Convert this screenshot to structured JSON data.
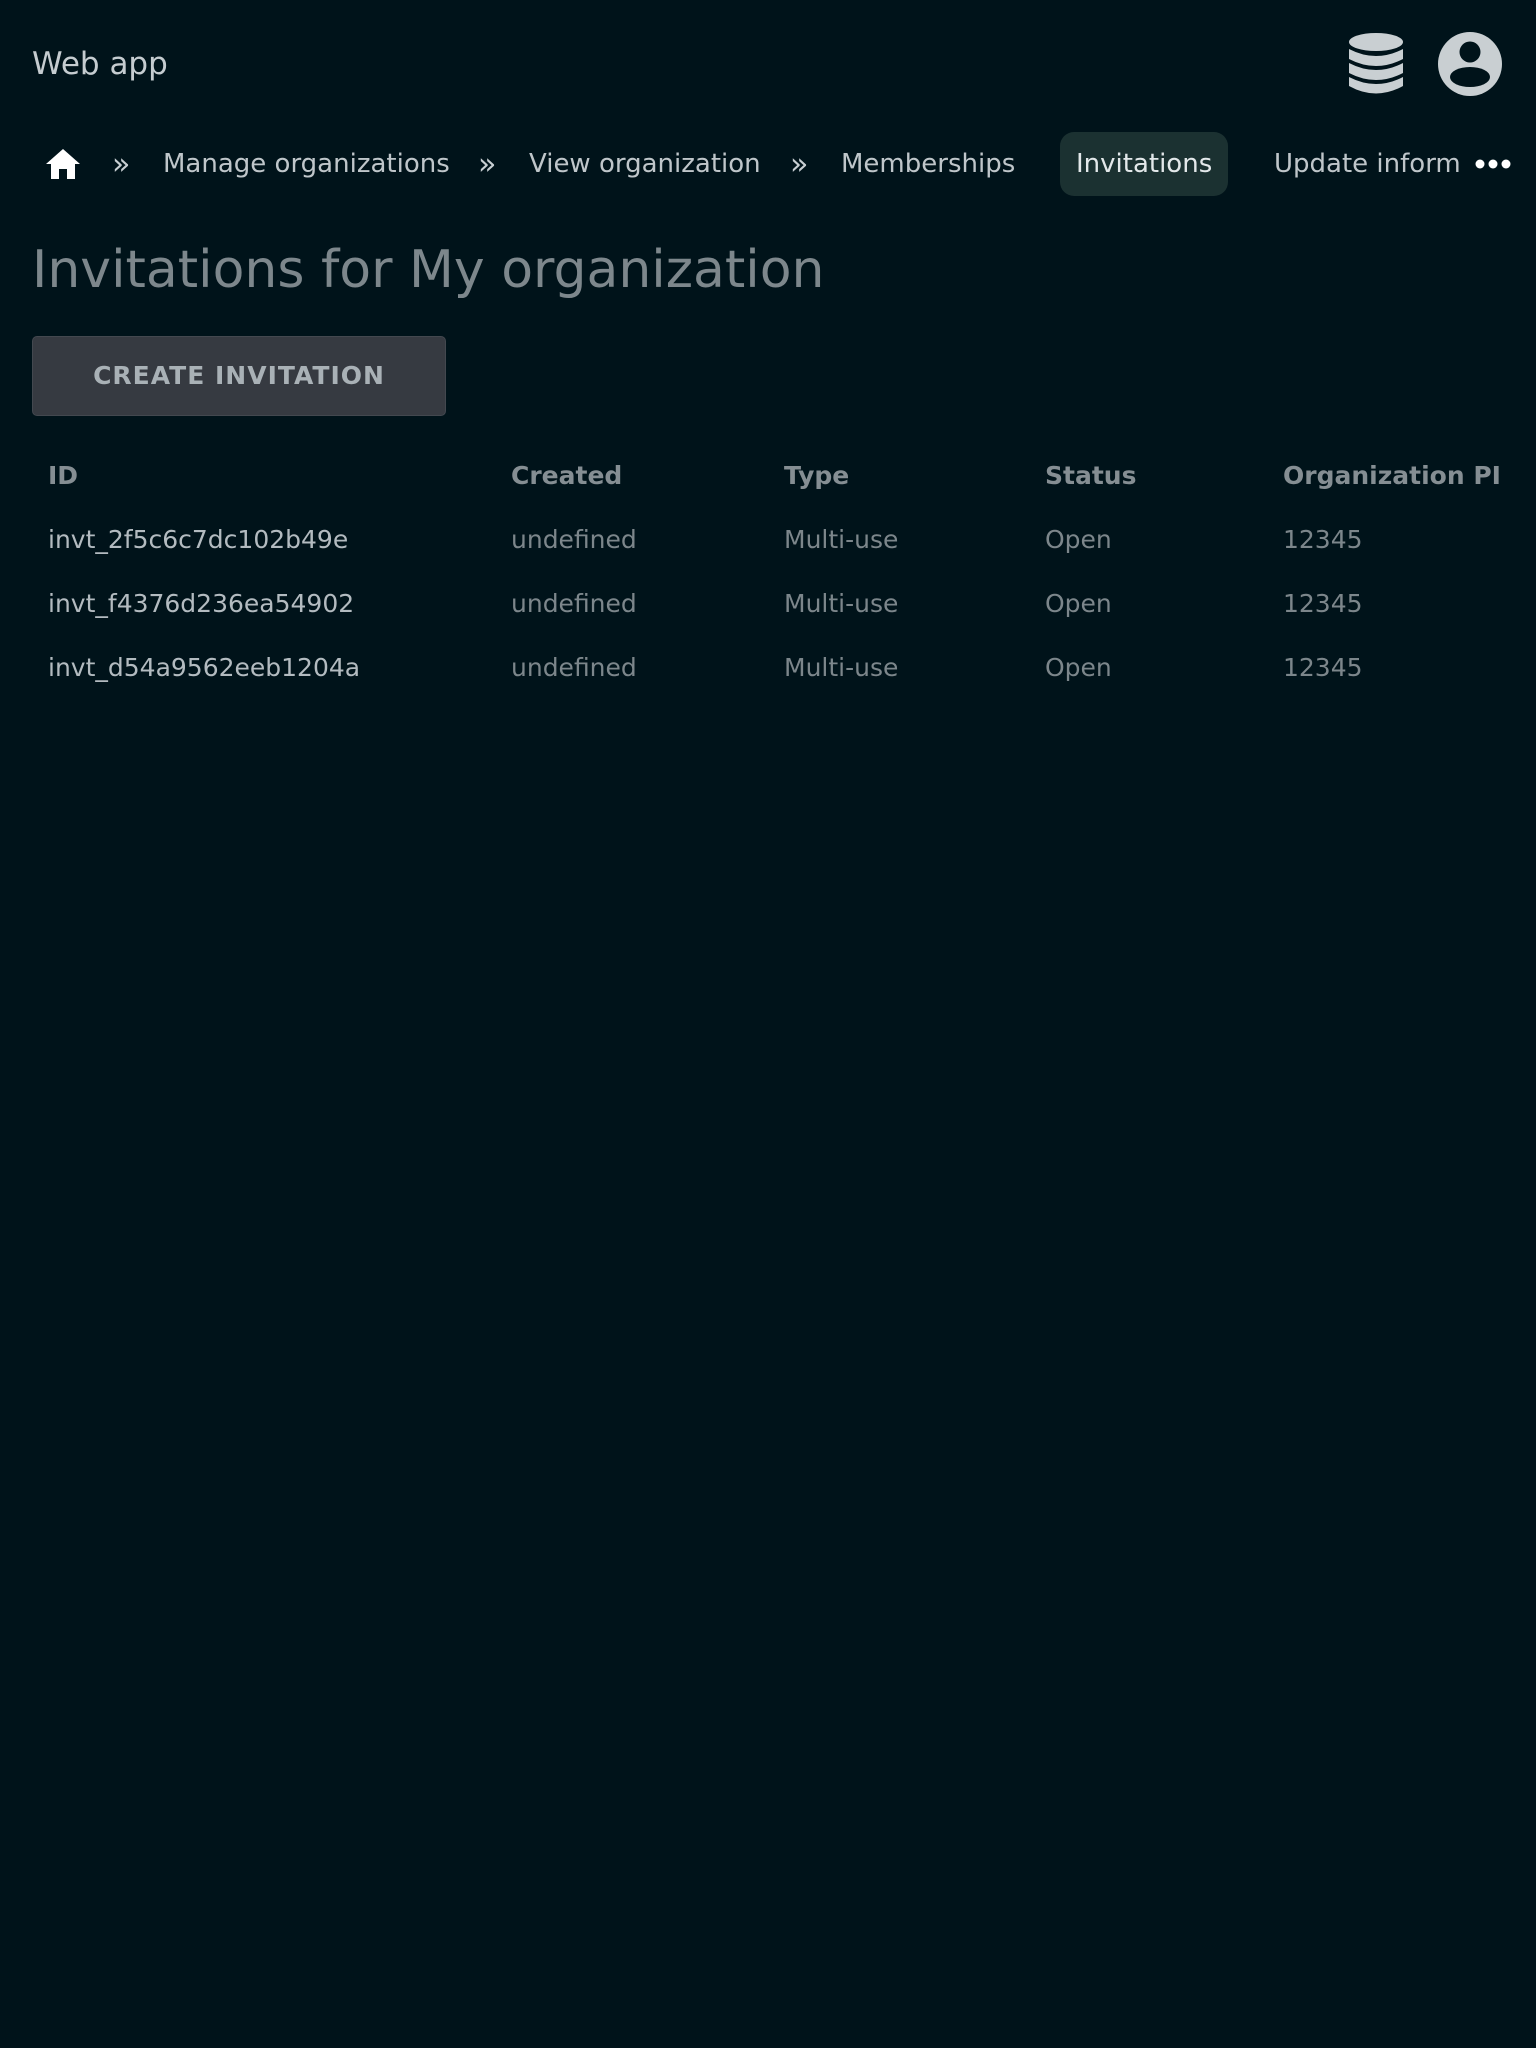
{
  "header": {
    "app_title": "Web app"
  },
  "breadcrumb": {
    "items": [
      {
        "label": "Manage organizations"
      },
      {
        "label": "View organization"
      },
      {
        "label": "Memberships"
      },
      {
        "label": "Invitations",
        "active": true
      },
      {
        "label": "Update inform"
      }
    ],
    "separator": "»"
  },
  "page": {
    "title": "Invitations for My organization",
    "create_button": "CREATE INVITATION"
  },
  "table": {
    "columns": [
      "ID",
      "Created",
      "Type",
      "Status",
      "Organization PI"
    ],
    "rows": [
      {
        "id": "invt_2f5c6c7dc102b49e",
        "created": "undefined",
        "type": "Multi-use",
        "status": "Open",
        "org": "12345"
      },
      {
        "id": "invt_f4376d236ea54902",
        "created": "undefined",
        "type": "Multi-use",
        "status": "Open",
        "org": "12345"
      },
      {
        "id": "invt_d54a9562eeb1204a",
        "created": "undefined",
        "type": "Multi-use",
        "status": "Open",
        "org": "12345"
      }
    ]
  },
  "colors": {
    "background": "#00131a",
    "active_crumb": "#1b3131",
    "button": "#363a41"
  },
  "icons": {
    "header": [
      "database-icon",
      "account-circle-icon"
    ],
    "breadcrumb": [
      "home-icon",
      "more-horizontal-icon"
    ]
  }
}
